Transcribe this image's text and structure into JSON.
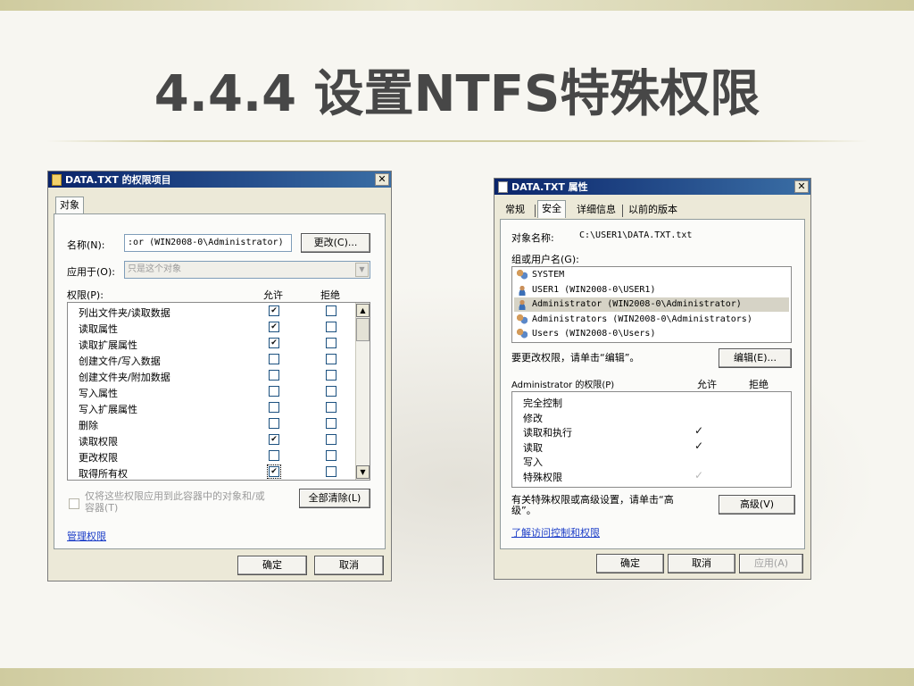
{
  "slide": {
    "title": "4.4.4 设置NTFS特殊权限"
  },
  "left_dialog": {
    "title": "DATA.TXT 的权限项目",
    "tab": "对象",
    "name_label": "名称(N):",
    "name_value": ":or (WIN2008-0\\Administrator)",
    "change_button": "更改(C)...",
    "apply_label": "应用于(O):",
    "apply_value": "只是这个对象",
    "permissions_label": "权限(P):",
    "allow_header": "允许",
    "deny_header": "拒绝",
    "permissions": [
      {
        "name": "列出文件夹/读取数据",
        "allow": true,
        "deny": false
      },
      {
        "name": "读取属性",
        "allow": true,
        "deny": false
      },
      {
        "name": "读取扩展属性",
        "allow": true,
        "deny": false
      },
      {
        "name": "创建文件/写入数据",
        "allow": false,
        "deny": false
      },
      {
        "name": "创建文件夹/附加数据",
        "allow": false,
        "deny": false
      },
      {
        "name": "写入属性",
        "allow": false,
        "deny": false
      },
      {
        "name": "写入扩展属性",
        "allow": false,
        "deny": false
      },
      {
        "name": "删除",
        "allow": false,
        "deny": false
      },
      {
        "name": "读取权限",
        "allow": true,
        "deny": false
      },
      {
        "name": "更改权限",
        "allow": false,
        "deny": false
      },
      {
        "name": "取得所有权",
        "allow": true,
        "deny": false
      }
    ],
    "apply_container_text": "仅将这些权限应用到此容器中的对象和/或容器(T)",
    "clear_all_button": "全部清除(L)",
    "manage_link": "管理权限",
    "ok_button": "确定",
    "cancel_button": "取消"
  },
  "right_dialog": {
    "title": "DATA.TXT 属性",
    "tabs": [
      "常规",
      "安全",
      "详细信息",
      "以前的版本"
    ],
    "active_tab": "安全",
    "object_name_label": "对象名称:",
    "object_name_value": "C:\\USER1\\DATA.TXT.txt",
    "groups_label": "组或用户名(G):",
    "users": [
      {
        "name": "SYSTEM",
        "icon": "group-icon"
      },
      {
        "name": "USER1 (WIN2008-0\\USER1)",
        "icon": "user-icon"
      },
      {
        "name": "Administrator (WIN2008-0\\Administrator)",
        "icon": "user-icon"
      },
      {
        "name": "Administrators (WIN2008-0\\Administrators)",
        "icon": "group-icon"
      },
      {
        "name": "Users (WIN2008-0\\Users)",
        "icon": "group-icon"
      }
    ],
    "selected_user_index": 2,
    "edit_hint": "要更改权限，请单击“编辑”。",
    "edit_button": "编辑(E)...",
    "perm_for_label": "Administrator 的权限(P)",
    "allow_header": "允许",
    "deny_header": "拒绝",
    "permissions": [
      {
        "name": "完全控制",
        "allow": "none"
      },
      {
        "name": "修改",
        "allow": "none"
      },
      {
        "name": "读取和执行",
        "allow": "check"
      },
      {
        "name": "读取",
        "allow": "check"
      },
      {
        "name": "写入",
        "allow": "none"
      },
      {
        "name": "特殊权限",
        "allow": "grey"
      }
    ],
    "advanced_hint_line1": "有关特殊权限或高级设置，请单击“高",
    "advanced_hint_line2": "级”。",
    "advanced_button": "高级(V)",
    "learn_link": "了解访问控制和权限",
    "ok_button": "确定",
    "cancel_button": "取消",
    "apply_button": "应用(A)"
  }
}
